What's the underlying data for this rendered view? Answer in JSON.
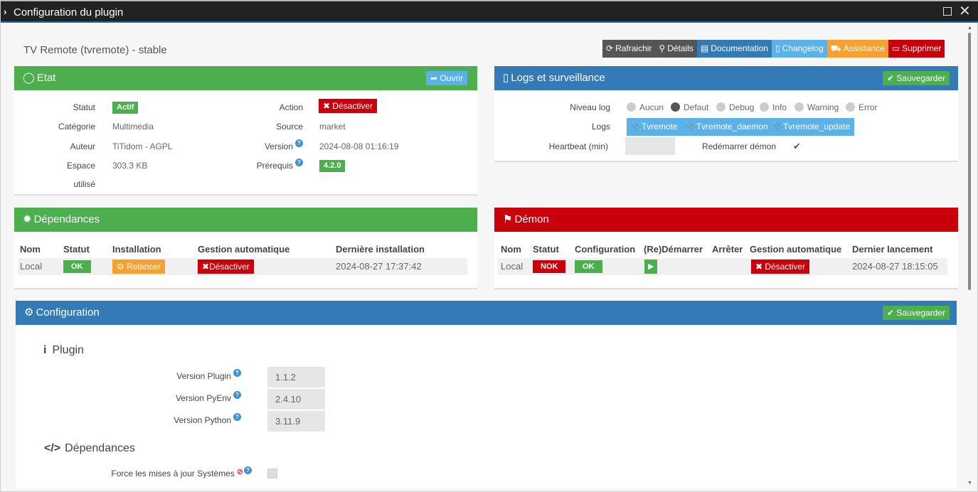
{
  "window": {
    "title": "Configuration du plugin"
  },
  "plugin": {
    "title": "TV Remote (tvremote) - stable",
    "buttons": [
      {
        "key": "refresh",
        "label": "Rafraichir",
        "icon": "refresh-icon",
        "color": "#555555"
      },
      {
        "key": "details",
        "label": "Détails",
        "icon": "search-icon",
        "color": "#555555"
      },
      {
        "key": "documentation",
        "label": "Documentation",
        "icon": "book-icon",
        "color": "#337ab7"
      },
      {
        "key": "changelog",
        "label": "Changelog",
        "icon": "file-icon",
        "color": "#5bb1e8"
      },
      {
        "key": "assistance",
        "label": "Assistance",
        "icon": "ambulance-icon",
        "color": "#f7a030"
      },
      {
        "key": "delete",
        "label": "Supprimer",
        "icon": "trash-icon",
        "color": "#c9000c"
      }
    ]
  },
  "etat": {
    "title": "Etat",
    "open_label": "Ouvrir",
    "statut_label": "Statut",
    "statut_value": "Actif",
    "categorie_label": "Catégorie",
    "categorie_value": "Multimédia",
    "auteur_label": "Auteur",
    "auteur_value": "TiTidom - AGPL",
    "espace_label_1": "Espace",
    "espace_label_2": "utilisé",
    "espace_value": "303.3 KB",
    "action_label": "Action",
    "action_value": "Désactiver",
    "source_label": "Source",
    "source_value": "market",
    "version_label": "Version",
    "version_value": "2024-08-08 01:16:19",
    "prerequis_label": "Prérequis",
    "prerequis_value": "4.2.0"
  },
  "logs": {
    "title": "Logs et surveillance",
    "save_label": "Sauvegarder",
    "niveau_label": "Niveau log",
    "levels": [
      "Aucun",
      "Defaut",
      "Debug",
      "Info",
      "Warning",
      "Error"
    ],
    "selected_level": "Defaut",
    "logs_label": "Logs",
    "log_files": [
      "Tvremote",
      "Tvremote_daemon",
      "Tvremote_update"
    ],
    "heartbeat_label": "Heartbeat (min)",
    "heartbeat_value": "",
    "restart_label": "Redémarrer démon",
    "restart_checked": true
  },
  "dependances": {
    "title": "Dépendances",
    "headers": [
      "Nom",
      "Statut",
      "Installation",
      "Gestion automatique",
      "Dernière installation"
    ],
    "row": {
      "nom": "Local",
      "statut": "OK",
      "installation": "Relancer",
      "gestion": "Désactiver",
      "derniere": "2024-08-27 17:37:42"
    }
  },
  "demon": {
    "title": "Démon",
    "headers": [
      "Nom",
      "Statut",
      "Configuration",
      "(Re)Démarrer",
      "Arrêter",
      "Gestion automatique",
      "Dernier lancement"
    ],
    "row": {
      "nom": "Local",
      "statut": "NOK",
      "configuration": "OK",
      "gestion": "Désactiver",
      "dernier": "2024-08-27 18:15:05"
    }
  },
  "configuration": {
    "title": "Configuration",
    "save_label": "Sauvegarder",
    "plugin_section": "Plugin",
    "fields": [
      {
        "label": "Version Plugin",
        "value": "1.1.2"
      },
      {
        "label": "Version PyEnv",
        "value": "2.4.10"
      },
      {
        "label": "Version Python",
        "value": "3.11.9"
      }
    ],
    "dep_section": "Dépendances",
    "force_label": "Force les mises à jour Systèmes"
  },
  "colors": {
    "green": "#4cae4c",
    "blue": "#337ab7",
    "red": "#c9000c",
    "orange": "#f7a030",
    "lightblue": "#5bb1e8"
  }
}
